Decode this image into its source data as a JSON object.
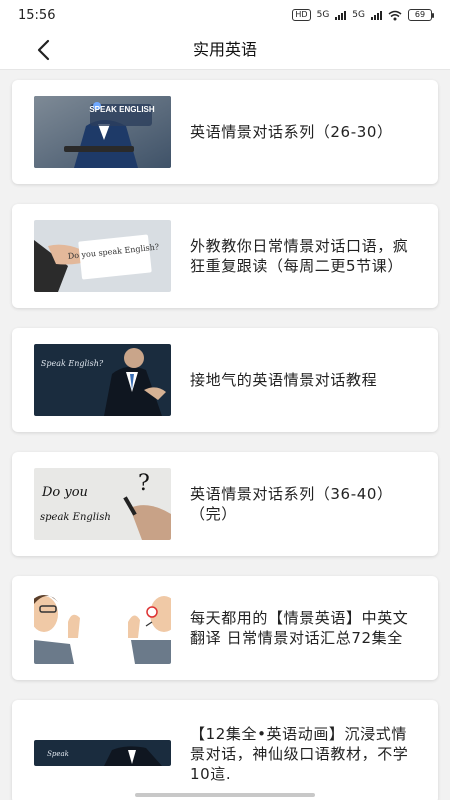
{
  "status": {
    "time": "15:56",
    "hd": "HD",
    "net1": "5G",
    "net2": "5G",
    "battery": "69"
  },
  "header": {
    "title": "实用英语"
  },
  "items": [
    {
      "title": "英语情景对话系列（26-30）",
      "image_text": "SPEAK ENGLISH"
    },
    {
      "title": "外教教你日常情景对话口语，疯狂重复跟读（每周二更5节课）",
      "image_text": "Do you speak English?"
    },
    {
      "title": "接地气的英语情景对话教程",
      "image_text": "Speak English?"
    },
    {
      "title": "英语情景对话系列（36-40）（完）",
      "image_text": "Do you speak English"
    },
    {
      "title": "每天都用的【情景英语】中英文翻译 日常情景对话汇总72集全",
      "image_text": ""
    },
    {
      "title": "【12集全•英语动画】沉浸式情景对话，神仙级口语教材，不学10這.",
      "image_text": "Speak"
    }
  ]
}
